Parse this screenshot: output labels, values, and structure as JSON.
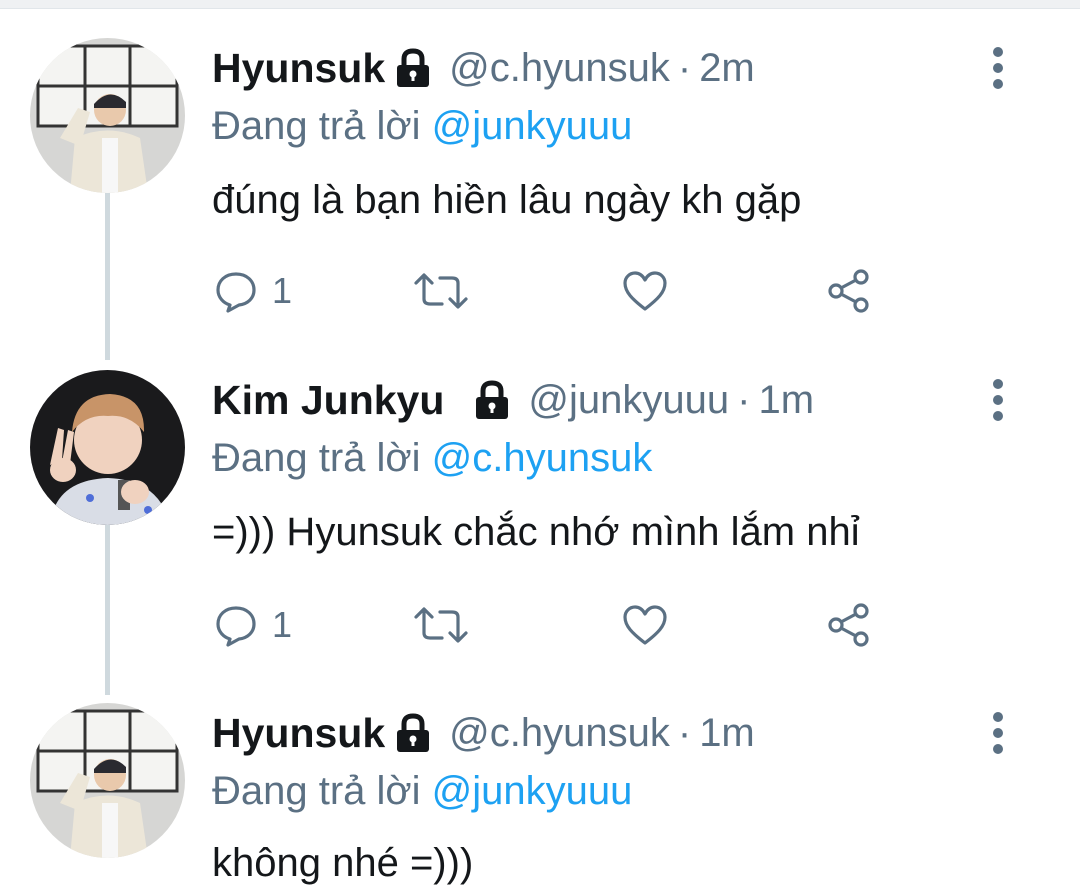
{
  "tweets": [
    {
      "name": "Hyunsuk",
      "handle": "@c.hyunsuk",
      "separator": "·",
      "time": "2m",
      "reply_prefix": "Đang trả lời",
      "reply_to": "@junkyuuu",
      "text": "đúng là bạn hiền lâu ngày kh gặp",
      "reply_count": "1",
      "icons": [
        "lock-icon",
        "more-vertical-icon",
        "reply-icon",
        "retweet-icon",
        "like-icon",
        "share-icon"
      ]
    },
    {
      "name": "Kim Junkyu",
      "handle": "@junkyuuu",
      "separator": "·",
      "time": "1m",
      "reply_prefix": "Đang trả lời",
      "reply_to": "@c.hyunsuk",
      "text": "=))) Hyunsuk chắc nhớ mình lắm nhỉ",
      "reply_count": "1",
      "icons": [
        "lock-icon",
        "more-vertical-icon",
        "reply-icon",
        "retweet-icon",
        "like-icon",
        "share-icon"
      ]
    },
    {
      "name": "Hyunsuk",
      "handle": "@c.hyunsuk",
      "separator": "·",
      "time": "1m",
      "reply_prefix": "Đang trả lời",
      "reply_to": "@junkyuuu",
      "text": "không nhé =)))",
      "icons": [
        "lock-icon",
        "more-vertical-icon"
      ]
    }
  ],
  "colors": {
    "text": "#14171a",
    "secondary": "#5b7083",
    "link": "#1da1f2",
    "thread_line": "#cfd9de"
  }
}
